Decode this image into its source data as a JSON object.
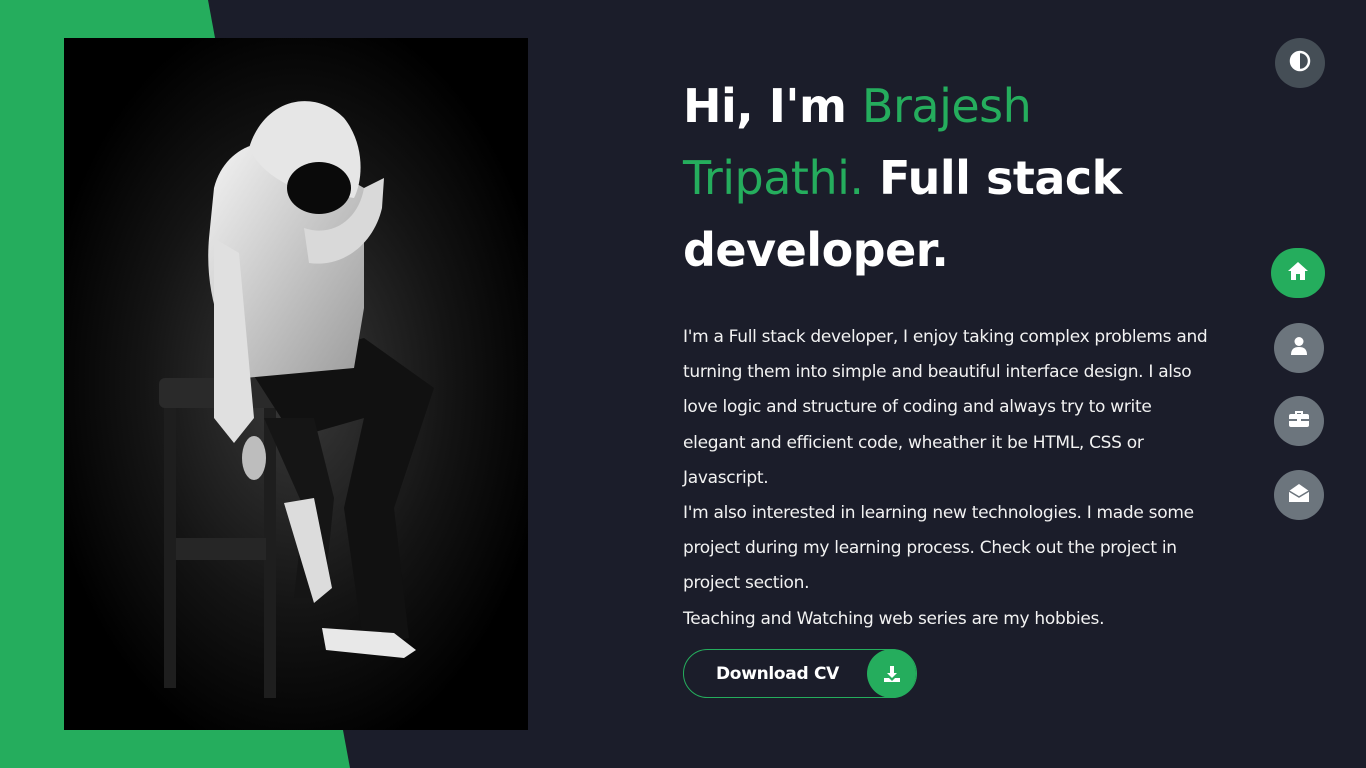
{
  "hero": {
    "greeting": "Hi, I'm ",
    "name_line1": "Brajesh",
    "name_line2": "Tripathi.",
    "role_line1": " Full stack",
    "role_line2": "developer."
  },
  "bio": {
    "paragraph1": "I'm a Full stack developer, I enjoy taking complex problems and turning them into simple and beautiful interface design. I also love logic and structure of coding and always try to write elegant and efficient code, wheather it be HTML, CSS or Javascript.",
    "paragraph2": "I'm also interested in learning new technologies. I made some project during my learning process. Check out the project in project section.",
    "paragraph3": "Teaching and Watching web series are my hobbies."
  },
  "download_button": {
    "label": "Download CV",
    "icon": "download-icon"
  },
  "theme_toggle": {
    "icon": "contrast-icon"
  },
  "side_nav": [
    {
      "icon": "home-icon",
      "active": true
    },
    {
      "icon": "user-icon",
      "active": false
    },
    {
      "icon": "briefcase-icon",
      "active": false
    },
    {
      "icon": "envelope-open-icon",
      "active": false
    }
  ],
  "colors": {
    "background": "#1b1d2a",
    "accent": "#25ad5d",
    "nav_inactive": "#6c757d",
    "theme_button": "#454e56",
    "text": "#ffffff"
  }
}
